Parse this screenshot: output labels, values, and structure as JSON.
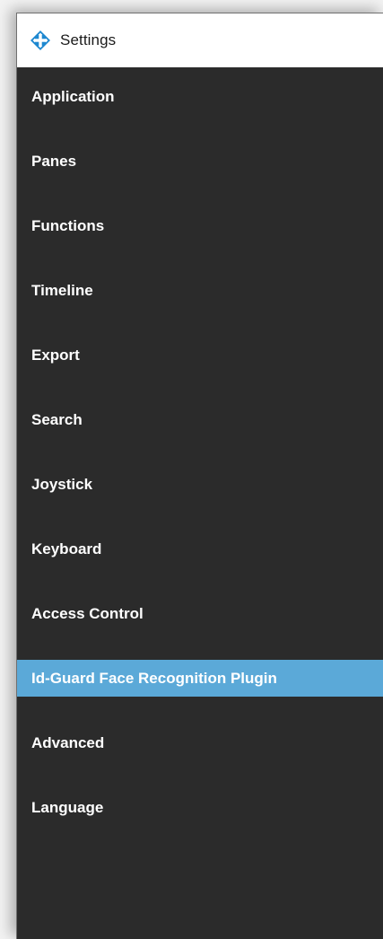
{
  "window": {
    "title": "Settings",
    "icon": "diamond-cross-logo-icon",
    "accent_color": "#5ba9d8",
    "background_color": "#2b2b2b"
  },
  "sidebar": {
    "selected_index": 9,
    "items": [
      {
        "label": "Application"
      },
      {
        "label": "Panes"
      },
      {
        "label": "Functions"
      },
      {
        "label": "Timeline"
      },
      {
        "label": "Export"
      },
      {
        "label": "Search"
      },
      {
        "label": "Joystick"
      },
      {
        "label": "Keyboard"
      },
      {
        "label": "Access Control"
      },
      {
        "label": "Id-Guard Face Recognition Plugin"
      },
      {
        "label": "Advanced"
      },
      {
        "label": "Language"
      }
    ]
  }
}
